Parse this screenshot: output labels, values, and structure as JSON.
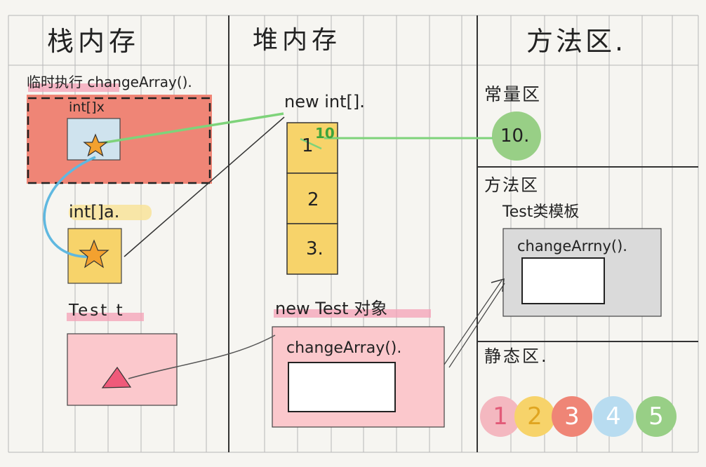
{
  "columns": {
    "stack_title": "栈内存",
    "heap_title": "堆内存",
    "method_area_title": "方法区."
  },
  "stack": {
    "frame_label": "临时执行 changeArray().",
    "var_x_label": "int[]x",
    "var_a_label": "int[]a.",
    "var_t_label": "Test t"
  },
  "heap": {
    "array_label": "new int[].",
    "array_cells": [
      "1",
      "2",
      "3."
    ],
    "overwrite_value": "10",
    "object_label": "new Test 对象",
    "object_method_label": "changeArray()."
  },
  "method_area": {
    "constant_pool_label": "常量区",
    "constant_value": "10.",
    "method_region_label": "方法区",
    "class_template_label": "Test类模板",
    "template_method_label": "changeArrny().",
    "static_region_label": "静态区."
  },
  "legend": {
    "items": [
      "1",
      "2",
      "3",
      "4",
      "5"
    ],
    "colors": [
      "#f4b8c0",
      "#f7d36a",
      "#ef8576",
      "#b8dcf0",
      "#98cf86"
    ],
    "text_colors": [
      "#e25a78",
      "#e0a520",
      "#ffffff",
      "#ffffff",
      "#ffffff"
    ]
  },
  "palette": {
    "frame_fill": "#ef8576",
    "var_x_fill": "#cfe3ee",
    "var_a_fill": "#f7d36a",
    "object_fill": "#fbc8cc",
    "array_fill": "#f7d36a",
    "template_fill": "#dadada",
    "highlight": "#f4a0b5",
    "green_link": "#7ed37a",
    "blue_link": "#5fb8e0",
    "star": "#f3a12f",
    "triangle": "#ef5a7a"
  }
}
